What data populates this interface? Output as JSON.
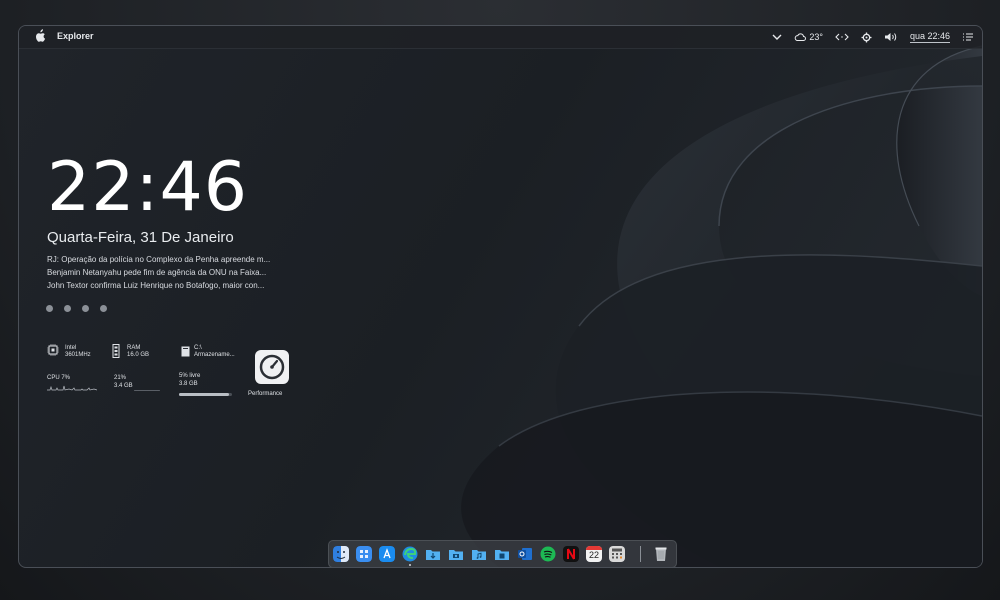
{
  "menubar": {
    "app_name": "Explorer",
    "temperature": "23°",
    "clock": "qua 22:46"
  },
  "desktop": {
    "time": "22:46",
    "date": "Quarta-Feira, 31 De Janeiro",
    "news": [
      "RJ: Operação da polícia no Complexo da Penha apreende m...",
      "Benjamin Netanyahu pede fim de agência da ONU na Faixa...",
      "John Textor confirma Luiz Henrique no Botafogo, maior con..."
    ]
  },
  "widgets": {
    "cpu": {
      "name": "Intel",
      "freq": "3601MHz",
      "label": "CPU 7%"
    },
    "ram": {
      "title": "RAM",
      "total": "16.0 GB",
      "percent": "21%",
      "used": "3.4 GB"
    },
    "disk": {
      "drive": "C:\\",
      "name": "Armazename...",
      "free_label": "5% livre",
      "free": "3.8 GB",
      "used_fraction": 0.95
    },
    "performance": {
      "label": "Performance"
    }
  },
  "dock": {
    "apps": [
      "finder-icon",
      "launchpad-icon",
      "app-store-icon",
      "edge-icon",
      "downloads-icon",
      "camera-folder-icon",
      "music-folder-icon",
      "documents-folder-icon",
      "outlook-icon",
      "spotify-icon",
      "netflix-icon",
      "calendar-icon",
      "calculator-icon",
      "trash-icon"
    ],
    "calendar_day": "22"
  },
  "colors": {
    "accent": "#2f7fe0",
    "spotify": "#1db954",
    "netflix": "#e50914"
  }
}
